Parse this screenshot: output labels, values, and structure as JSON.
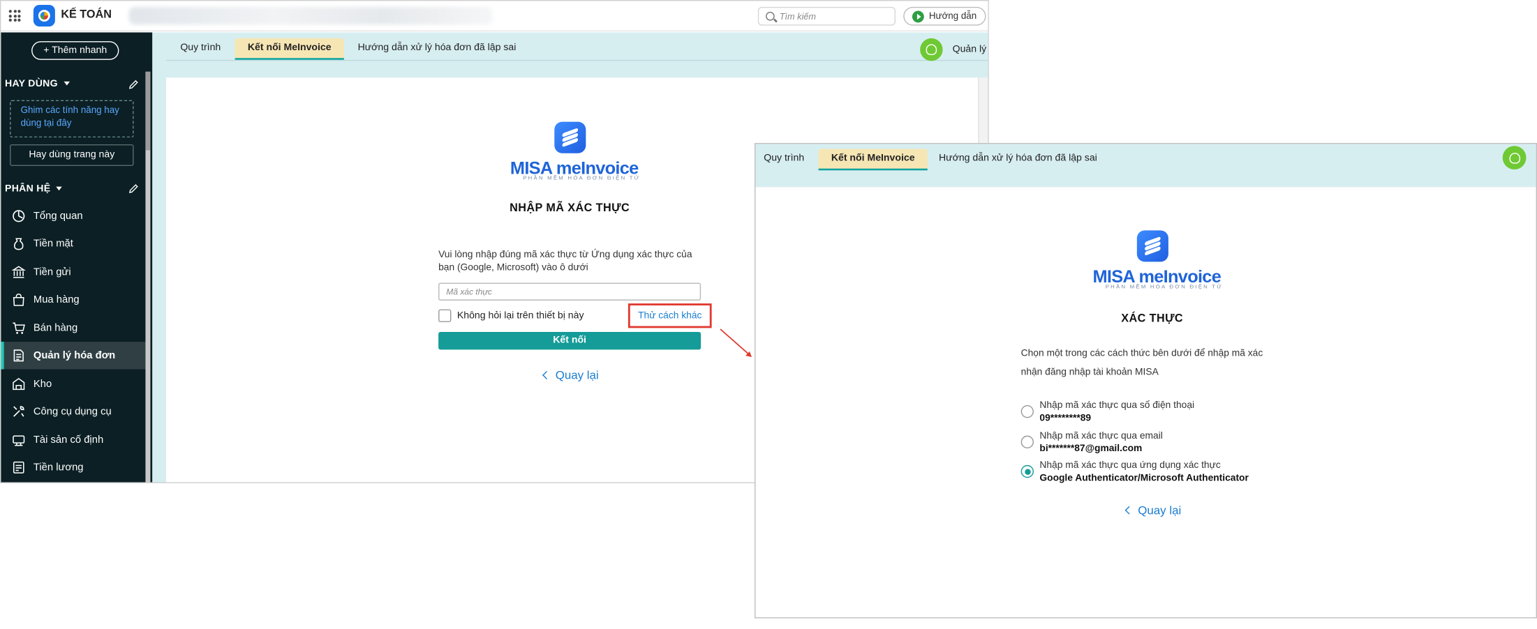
{
  "app": {
    "title": "KẾ TOÁN",
    "search_placeholder": "Tìm kiếm",
    "guide_label": "Hướng dẫn"
  },
  "sidebar": {
    "quick_add_label": "+ Thêm nhanh",
    "favorites_heading": "HAY DÙNG",
    "favorites_hint": "Ghim các tính năng hay dùng tại đây",
    "favorite_this_page": "Hay dùng trang này",
    "modules_heading": "PHÂN HỆ",
    "items": [
      {
        "label": "Tổng quan",
        "icon": "dashboard-icon"
      },
      {
        "label": "Tiền mặt",
        "icon": "cash-bag-icon"
      },
      {
        "label": "Tiền gửi",
        "icon": "bank-icon"
      },
      {
        "label": "Mua hàng",
        "icon": "shopping-bag-icon"
      },
      {
        "label": "Bán hàng",
        "icon": "cart-icon"
      },
      {
        "label": "Quản lý hóa đơn",
        "icon": "invoice-icon",
        "active": true
      },
      {
        "label": "Kho",
        "icon": "warehouse-icon"
      },
      {
        "label": "Công cụ dụng cụ",
        "icon": "tools-icon"
      },
      {
        "label": "Tài sản cố định",
        "icon": "asset-icon"
      },
      {
        "label": "Tiền lương",
        "icon": "payroll-icon"
      }
    ]
  },
  "tabs": [
    {
      "label": "Quy trình"
    },
    {
      "label": "Kết nối MeInvoice",
      "active": true
    },
    {
      "label": "Hướng dẫn xử lý hóa đơn đã lập sai"
    }
  ],
  "manager_label": "Quản lý v",
  "logo": {
    "brand_misa": "MISA",
    "brand_product": "meInvoice",
    "tagline": "PHẦN MỀM HÓA ĐƠN ĐIỆN TỬ"
  },
  "verify_form": {
    "title": "NHẬP MÃ XÁC THỰC",
    "description": "Vui lòng nhập đúng mã xác thực từ Ứng dụng xác thực của bạn (Google, Microsoft) vào ô dưới",
    "code_placeholder": "Mã xác thực",
    "remember_label": "Không hỏi lại trên thiết bị này",
    "try_other_label": "Thử cách khác",
    "connect_label": "Kết nối",
    "back_label": "Quay lại"
  },
  "method_form": {
    "title": "XÁC THỰC",
    "description": "Chọn một trong các cách thức bên dưới để nhập mã xác nhận đăng nhập tài khoản MISA",
    "options": [
      {
        "label": "Nhập mã xác thực qua số điện thoại",
        "value": "09********89",
        "selected": false
      },
      {
        "label": "Nhập mã xác thực qua email",
        "value": "bi*******87@gmail.com",
        "selected": false
      },
      {
        "label": "Nhập mã xác thực qua ứng dụng xác thực",
        "value": "Google Authenticator/Microsoft Authenticator",
        "selected": true
      }
    ],
    "back_label": "Quay lại"
  },
  "colors": {
    "sidebar_bg": "#0b1f24",
    "accent_teal": "#159c98",
    "tab_active_bg": "#f6e6b4",
    "content_bg": "#d7eef1",
    "link_blue": "#1a7ed1",
    "highlight_red": "#e0392f",
    "brand_blue": "#1f64d8"
  }
}
